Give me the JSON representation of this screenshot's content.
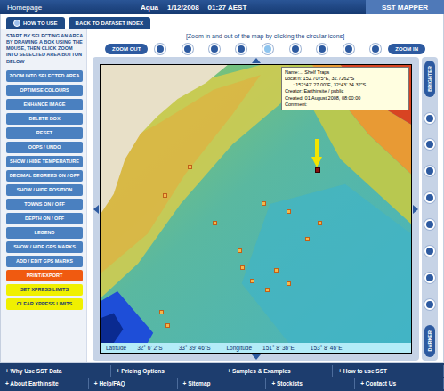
{
  "top_bar": {
    "home": "Homepage",
    "satellite": "Aqua",
    "date": "1/12/2008",
    "time": "01:27 AEST",
    "brand": "SST MAPPER"
  },
  "tabs": [
    {
      "label": "HOW TO USE"
    },
    {
      "label": "BACK TO DATASET INDEX"
    }
  ],
  "hint": "[Zoom in and out of the map by clicking the circular icons]",
  "sidebar": {
    "instructions": "START BY SELECTING AN AREA BY DRAWING A BOX USING THE MOUSE, THEN CLICK ZOOM INTO SELECTED AREA BUTTON BELOW",
    "buttons": [
      {
        "label": "ZOOM INTO SELECTED AREA",
        "kind": "blue"
      },
      {
        "label": "OPTIMISE COLOURS",
        "kind": "blue"
      },
      {
        "label": "ENHANCE IMAGE",
        "kind": "blue"
      },
      {
        "label": "DELETE BOX",
        "kind": "blue"
      },
      {
        "label": "RESET",
        "kind": "blue"
      },
      {
        "label": "OOPS / UNDO",
        "kind": "blue"
      },
      {
        "label": "SHOW / HIDE TEMPERATURE",
        "kind": "blue"
      },
      {
        "label": "DECIMAL DEGREES ON / OFF",
        "kind": "blue"
      },
      {
        "label": "SHOW / HIDE POSITION",
        "kind": "blue"
      },
      {
        "label": "TOWNS ON / OFF",
        "kind": "blue"
      },
      {
        "label": "DEPTH ON / OFF",
        "kind": "blue"
      },
      {
        "label": "LEGEND",
        "kind": "blue"
      },
      {
        "label": "SHOW / HIDE GPS MARKS",
        "kind": "blue"
      },
      {
        "label": "ADD / EDIT GPS MARKS",
        "kind": "blue"
      },
      {
        "label": "PRINT/EXPORT",
        "kind": "orange"
      },
      {
        "label": "SET XPRESS LIMITS",
        "kind": "yellow"
      },
      {
        "label": "CLEAR XPRESS LIMITS",
        "kind": "yellow"
      }
    ]
  },
  "zoom": {
    "out_label": "ZOOM OUT",
    "in_label": "ZOOM IN",
    "levels": [
      {
        "selected": false
      },
      {
        "selected": false
      },
      {
        "selected": false
      },
      {
        "selected": false
      },
      {
        "selected": true
      },
      {
        "selected": false
      },
      {
        "selected": false
      },
      {
        "selected": false
      },
      {
        "selected": false
      }
    ]
  },
  "brightness": {
    "brighter_label": "BRIGHTER",
    "darker_label": "DARKER",
    "steps": 8
  },
  "tooltip": {
    "lines": [
      "Name:... Shelf Traps",
      "Locat'n: 152.7075°E, 32.7262°S",
      "......: 152°42' 27.00\"E, 32°43' 34.32\"S",
      "Creator: Earthinsite / public",
      "Created: 01 August 2008, 08:00:00",
      "Comment:"
    ]
  },
  "coordinates": {
    "latitude_label": "Latitude",
    "lat_from": "32° 6' 2\"S",
    "lat_to": "33° 39' 46\"S",
    "longitude_label": "Longitude",
    "lon_from": "151° 8' 36\"E",
    "lon_to": "153° 8' 46\"E"
  },
  "footer": {
    "rows": [
      [
        "+ Why Use SST Data",
        "+ Pricing Options",
        "+ Samples & Examples",
        "+ How to use SST"
      ],
      [
        "+ About Earthinsite",
        "+ Help/FAQ",
        "+ Sitemap",
        "+ Stockists",
        "+ Contact Us"
      ]
    ]
  }
}
